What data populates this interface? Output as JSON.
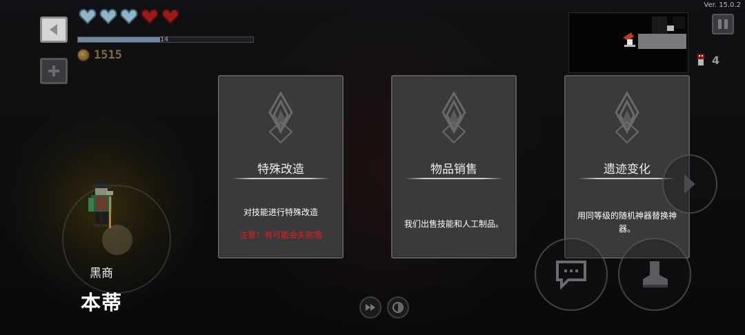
{
  "hud": {
    "version": "Ver. 15.0.2",
    "xp_label": "14",
    "xp_fraction": 0.47,
    "coins": "1515",
    "hearts": [
      "blue",
      "blue",
      "blue",
      "red",
      "red"
    ],
    "enemy_count": "4"
  },
  "npc": {
    "title": "黑商",
    "name": "本蒂"
  },
  "cards": [
    {
      "title": "特殊改造",
      "description": "对技能进行特殊改造",
      "warning": "注意！有可能会失败哦"
    },
    {
      "title": "物品销售",
      "description": "我们出售技能和人工制品。"
    },
    {
      "title": "遗迹变化",
      "description": "用同等级的随机神器替换神器。"
    }
  ],
  "colors": {
    "card_bg": "#3b3a3a",
    "warning": "#e02020",
    "heart_blue": "#8fb4c8",
    "heart_red": "#9a1a1a",
    "coin_text": "#7b6a45"
  },
  "icons": {
    "back": "back-arrow-icon",
    "plus": "plus-icon",
    "pause": "pause-icon",
    "chat": "chat-icon",
    "skill": "boot-icon",
    "next": "chevron-right-icon",
    "emblem": "diamond-emblem-icon"
  }
}
